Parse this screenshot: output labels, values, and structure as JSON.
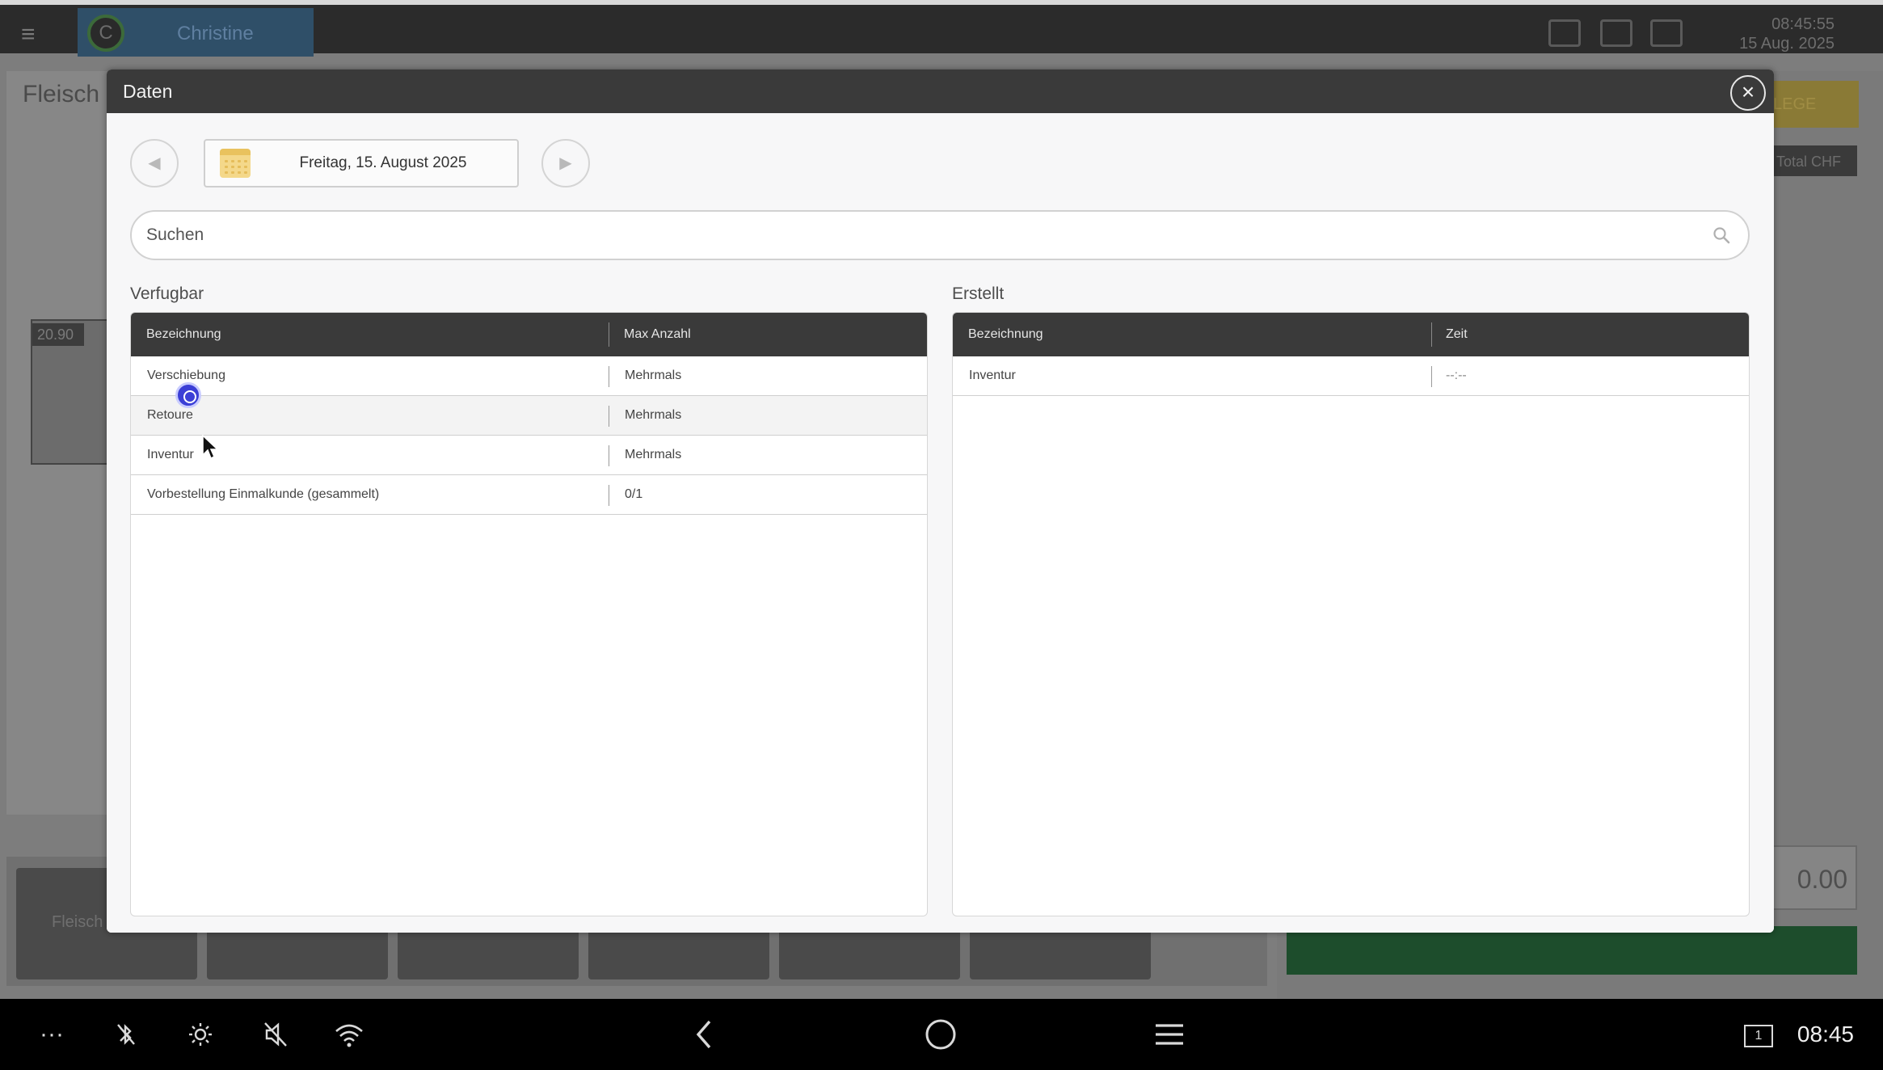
{
  "background": {
    "username": "Christine",
    "avatar_initial": "C",
    "time": "08:45:55",
    "date": "15 Aug. 2025",
    "page_title": "Fleisch",
    "price": "20.90",
    "yellow_button": "LEGE",
    "total_label": "Total CHF",
    "amount": "0.00",
    "strip_label": "Fleisch"
  },
  "modal": {
    "title": "Daten",
    "close_symbol": "×",
    "date_label": "Freitag, 15. August 2025",
    "search_placeholder": "Suchen",
    "available": {
      "label": "Verfugbar",
      "columns": [
        "Bezeichnung",
        "Max Anzahl"
      ],
      "rows": [
        {
          "name": "Verschiebung",
          "max": "Mehrmals"
        },
        {
          "name": "Retoure",
          "max": "Mehrmals"
        },
        {
          "name": "Inventur",
          "max": "Mehrmals"
        },
        {
          "name": "Vorbestellung Einmalkunde (gesammelt)",
          "max": "0/1"
        }
      ]
    },
    "created": {
      "label": "Erstellt",
      "columns": [
        "Bezeichnung",
        "Zeit"
      ],
      "rows": [
        {
          "name": "Inventur",
          "time": "--:--"
        }
      ]
    }
  },
  "navbar": {
    "more": "···",
    "screen_number": "1",
    "time": "08:45"
  }
}
